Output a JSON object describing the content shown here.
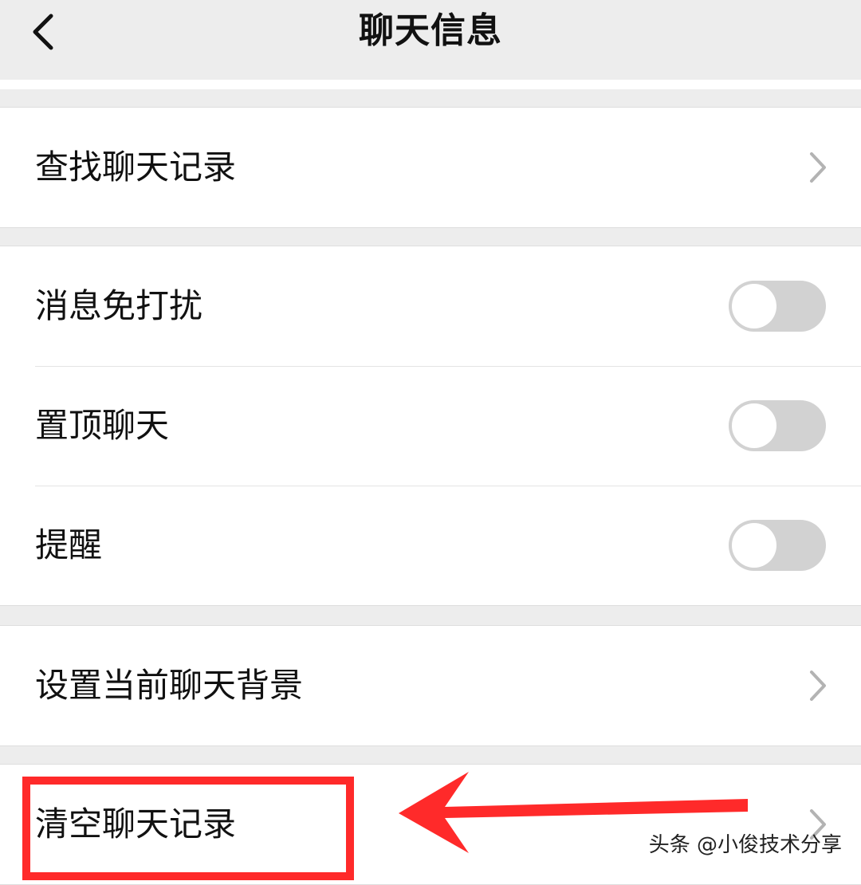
{
  "header": {
    "title": "聊天信息",
    "back_icon": "chevron-left-icon"
  },
  "groups": [
    {
      "rows": [
        {
          "label": "查找聊天记录",
          "control": "chevron-right-icon"
        }
      ]
    },
    {
      "rows": [
        {
          "label": "消息免打扰",
          "control": "toggle",
          "on": false
        },
        {
          "label": "置顶聊天",
          "control": "toggle",
          "on": false
        },
        {
          "label": "提醒",
          "control": "toggle",
          "on": false
        }
      ]
    },
    {
      "rows": [
        {
          "label": "设置当前聊天背景",
          "control": "chevron-right-icon"
        }
      ]
    },
    {
      "rows": [
        {
          "label": "清空聊天记录",
          "control": "chevron-right-icon"
        }
      ]
    }
  ],
  "annotation": {
    "highlight_color": "#ff2a2a",
    "arrow_color": "#ff2a2a"
  },
  "watermark": {
    "text": "头条 @小俊技术分享"
  },
  "colors": {
    "background": "#ededed",
    "row_background": "#ffffff",
    "text": "#111111",
    "toggle_off": "#d2d2d2",
    "chevron": "#b3b3b3"
  }
}
